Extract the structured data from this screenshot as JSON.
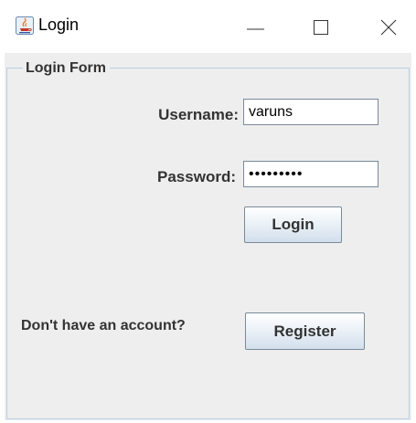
{
  "window": {
    "title": "Login",
    "app_icon": "java-icon",
    "controls": {
      "minimize": "minimize-icon",
      "maximize": "maximize-icon",
      "close": "close-icon"
    }
  },
  "form": {
    "group_title": "Login Form",
    "username_label": "Username:",
    "username_value": "varuns",
    "password_label": "Password:",
    "password_value": "•••••••••",
    "login_button": "Login",
    "account_prompt": "Don't have an account?",
    "register_button": "Register"
  },
  "colors": {
    "content_bg": "#eeeeee",
    "group_border": "#b8cfe5",
    "label_text": "#333333"
  }
}
